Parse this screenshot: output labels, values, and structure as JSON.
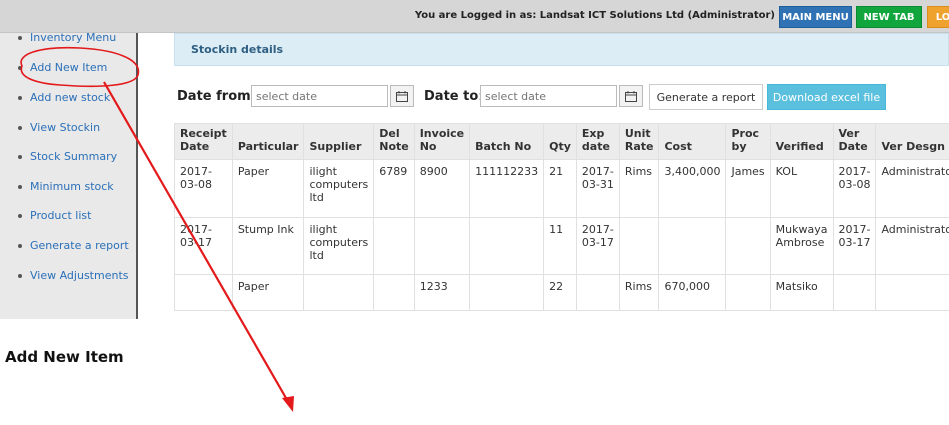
{
  "topbar": {
    "login_text": "You are Logged in as: Landsat ICT Solutions Ltd (Administrator)",
    "main_menu_label": "MAIN MENU",
    "new_tab_label": "NEW TAB",
    "logout_label": "LO",
    "colors": {
      "main_menu": "#2f73b4",
      "new_tab": "#11a53d",
      "logout": "#f0a22f"
    }
  },
  "sidebar": {
    "items": [
      {
        "label": "Inventory Menu"
      },
      {
        "label": "Add New Item"
      },
      {
        "label": "Add new stock"
      },
      {
        "label": "View Stockin"
      },
      {
        "label": "Stock Summary"
      },
      {
        "label": "Minimum stock"
      },
      {
        "label": "Product list"
      },
      {
        "label": "Generate a report"
      },
      {
        "label": "View Adjustments"
      }
    ]
  },
  "panel": {
    "title": "Stockin details"
  },
  "filters": {
    "date_from_label": "Date from",
    "date_from_placeholder": "select date",
    "date_to_label": "Date to",
    "date_to_placeholder": "select date",
    "generate_label": "Generate a report",
    "excel_label": "Download excel file",
    "calendar_icon": "calendar-icon"
  },
  "table": {
    "headers": [
      "Receipt Date",
      "Particular",
      "Supplier",
      "Del Note",
      "Invoice No",
      "Batch No",
      "Qty",
      "Exp date",
      "Unit Rate",
      "Cost",
      "Proc by",
      "Verified",
      "Ver Date",
      "Ver Desgn"
    ],
    "rows": [
      [
        "2017-03-08",
        "Paper",
        "ilight computers ltd",
        "6789",
        "8900",
        "111112233",
        "21",
        "2017-03-31",
        "Rims",
        "3,400,000",
        "James",
        "KOL",
        "2017-03-08",
        "Administrator"
      ],
      [
        "2017-03-17",
        "Stump Ink",
        "ilight computers ltd",
        "",
        "",
        "",
        "11",
        "2017-03-17",
        "",
        "",
        "",
        "Mukwaya Ambrose",
        "2017-03-17",
        "Administrator"
      ],
      [
        "",
        "Paper",
        "",
        "",
        "1233",
        "",
        "22",
        "",
        "Rims",
        "670,000",
        "",
        "Matsiko",
        "",
        ""
      ]
    ]
  },
  "section_title": "Add New Item",
  "annotation": {
    "color": "#e3191b"
  }
}
